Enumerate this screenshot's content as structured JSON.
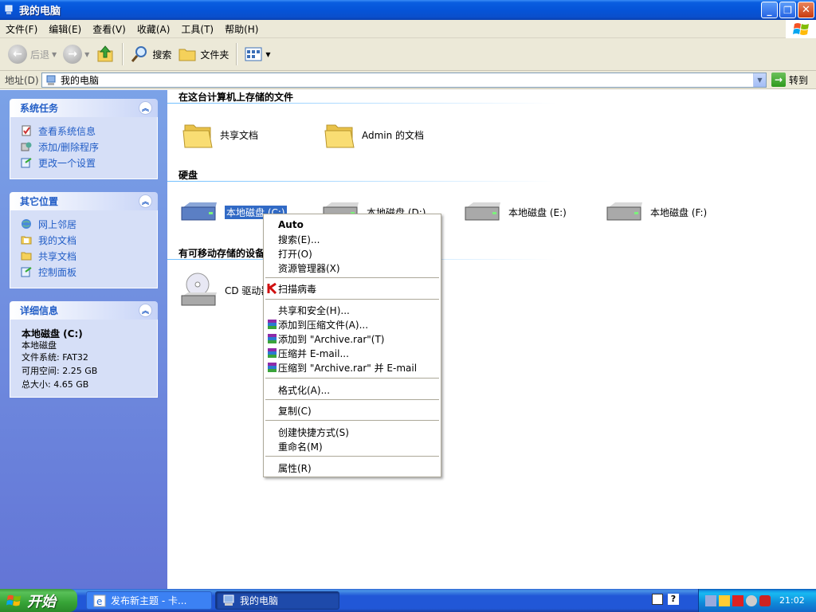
{
  "window": {
    "title": "我的电脑"
  },
  "menu": [
    "文件(F)",
    "编辑(E)",
    "查看(V)",
    "收藏(A)",
    "工具(T)",
    "帮助(H)"
  ],
  "toolbar": {
    "back_label": "后退",
    "search_label": "搜索",
    "folders_label": "文件夹"
  },
  "address": {
    "label": "地址(D)",
    "value": "我的电脑",
    "go_label": "转到"
  },
  "left": {
    "system_tasks": {
      "title": "系统任务",
      "items": [
        "查看系统信息",
        "添加/删除程序",
        "更改一个设置"
      ]
    },
    "other_places": {
      "title": "其它位置",
      "items": [
        "网上邻居",
        "我的文档",
        "共享文档",
        "控制面板"
      ]
    },
    "details": {
      "title": "详细信息",
      "name": "本地磁盘 (C:)",
      "type": "本地磁盘",
      "filesystem": "文件系统: FAT32",
      "free": "可用空间: 2.25 GB",
      "total": "总大小: 4.65 GB"
    }
  },
  "content": {
    "stored_files": {
      "title": "在这台计算机上存储的文件",
      "items": [
        "共享文档",
        "Admin 的文档"
      ]
    },
    "hard_disks": {
      "title": "硬盘",
      "items": [
        "本地磁盘 (C:)",
        "本地磁盘 (D:)",
        "本地磁盘 (E:)",
        "本地磁盘 (F:)"
      ]
    },
    "removable": {
      "title": "有可移动存储的设备",
      "items": [
        "CD 驱动器"
      ]
    }
  },
  "context_menu": {
    "items": [
      "Auto",
      "搜索(E)...",
      "打开(O)",
      "资源管理器(X)",
      "扫描病毒",
      "共享和安全(H)...",
      "添加到压缩文件(A)...",
      "添加到 \"Archive.rar\"(T)",
      "压缩并 E-mail...",
      "压缩到 \"Archive.rar\" 并 E-mail",
      "格式化(A)...",
      "复制(C)",
      "创建快捷方式(S)",
      "重命名(M)",
      "属性(R)"
    ]
  },
  "taskbar": {
    "start_label": "开始",
    "tasks": [
      "发布新主题 - 卡...",
      "我的电脑"
    ],
    "clock": "21:02"
  }
}
